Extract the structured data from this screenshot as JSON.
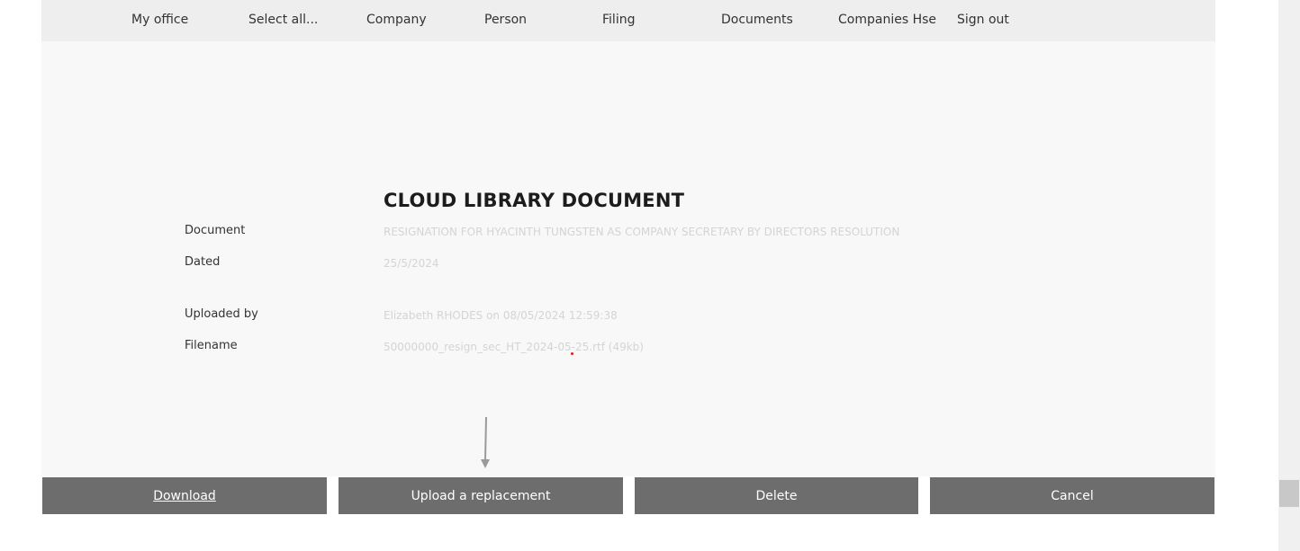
{
  "nav": {
    "items": [
      {
        "label": "My office"
      },
      {
        "label": "Select all..."
      },
      {
        "label": "Company"
      },
      {
        "label": "Person"
      },
      {
        "label": "Filing"
      },
      {
        "label": "Documents"
      },
      {
        "label": "Companies Hse"
      },
      {
        "label": "Sign out"
      }
    ]
  },
  "page": {
    "title": "CLOUD LIBRARY DOCUMENT"
  },
  "details": {
    "document_label": "Document",
    "document_value": "RESIGNATION FOR HYACINTH TUNGSTEN AS COMPANY SECRETARY BY DIRECTORS RESOLUTION",
    "dated_label": "Dated",
    "dated_value": "25/5/2024",
    "uploaded_by_label": "Uploaded by",
    "uploaded_by_value": "Elizabeth RHODES on 08/05/2024 12:59:38",
    "filename_label": "Filename",
    "filename_value": "50000000_resign_sec_HT_2024-05-25.rtf (49kb)"
  },
  "actions": {
    "download_label": "Download",
    "upload_label": "Upload a replacement",
    "delete_label": "Delete",
    "cancel_label": "Cancel"
  },
  "colors": {
    "button_bg": "#6d6d6d",
    "content_bg": "#f8f8f8",
    "nav_bg": "#eeeeee",
    "value_text": "#d4d4d4"
  }
}
